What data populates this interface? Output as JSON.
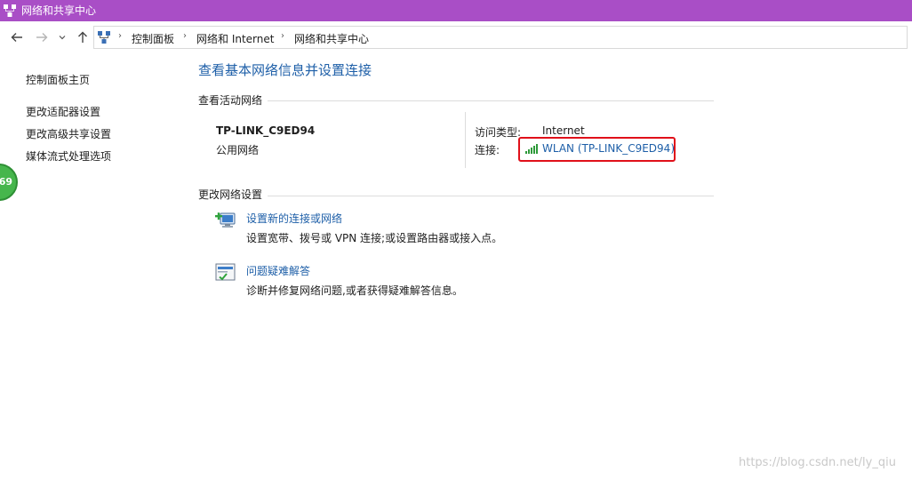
{
  "window": {
    "title": "网络和共享中心",
    "app_icon": "network-center-icon"
  },
  "navigation": {
    "back_icon": "back-arrow-icon",
    "forward_icon": "forward-arrow-icon",
    "recent_icon": "chevron-down-icon",
    "up_icon": "up-arrow-icon",
    "breadcrumbs": [
      "控制面板",
      "网络和 Internet",
      "网络和共享中心"
    ]
  },
  "sidebar": {
    "items": [
      "控制面板主页",
      "更改适配器设置",
      "更改高级共享设置",
      "媒体流式处理选项"
    ],
    "badge": "69"
  },
  "main": {
    "title": "查看基本网络信息并设置连接",
    "active_networks": {
      "heading": "查看活动网络",
      "network_name": "TP-LINK_C9ED94",
      "network_type": "公用网络",
      "access_type_label": "访问类型:",
      "access_type_value": "Internet",
      "connection_label": "连接:",
      "connection_value": "WLAN (TP-LINK_C9ED94)",
      "connection_icon": "wifi-signal-icon"
    },
    "change_settings": {
      "heading": "更改网络设置",
      "tasks": [
        {
          "icon": "new-connection-icon",
          "link": "设置新的连接或网络",
          "description": "设置宽带、拨号或 VPN 连接;或设置路由器或接入点。"
        },
        {
          "icon": "troubleshoot-icon",
          "link": "问题疑难解答",
          "description": "诊断并修复网络问题,或者获得疑难解答信息。"
        }
      ]
    }
  },
  "watermark": "https://blog.csdn.net/ly_qiu",
  "colors": {
    "titlebar": "#a94ec6",
    "link": "#1e5fa8",
    "highlight_box": "#e0101a",
    "badge": "#46b64c"
  }
}
